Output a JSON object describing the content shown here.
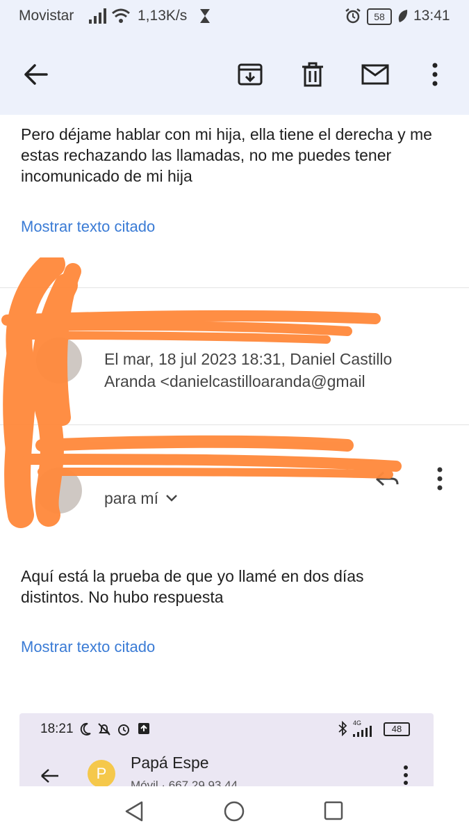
{
  "status_bar": {
    "carrier": "Movistar",
    "speed": "1,13K/s",
    "battery": "58",
    "time": "13:41"
  },
  "toolbar": {
    "icons": [
      "back-arrow-icon",
      "archive-icon",
      "trash-icon",
      "mark-unread-icon",
      "more-vert-icon"
    ]
  },
  "message1": {
    "body": "Pero déjame hablar con mi hija, ella tiene el derecha y me estas rechazando las llamadas, no me puedes tener incomunicado de mi hija",
    "show_quoted": "Mostrar texto citado"
  },
  "header1": {
    "meta_line1": "El mar, 18 jul 2023 18:31, Daniel Castillo",
    "meta_line2": "Aranda <danielcastilloaranda@gmail"
  },
  "header2": {
    "recipient": "para mí"
  },
  "message2": {
    "body_line1": "Aquí está la prueba de que yo llamé en dos días",
    "body_line2": "distintos. No hubo respuesta",
    "show_quoted": "Mostrar texto citado"
  },
  "attachment": {
    "time": "18:21",
    "battery": "48",
    "network": "4G",
    "avatar_letter": "P",
    "contact_name": "Papá Espe",
    "contact_sub": "Móvil · 667 29 93 44"
  },
  "colors": {
    "toolbar_bg": "#edf1fb",
    "link": "#3a7bd5",
    "scribble": "#ff8a3d",
    "embed_bg": "#ebe7f3"
  }
}
